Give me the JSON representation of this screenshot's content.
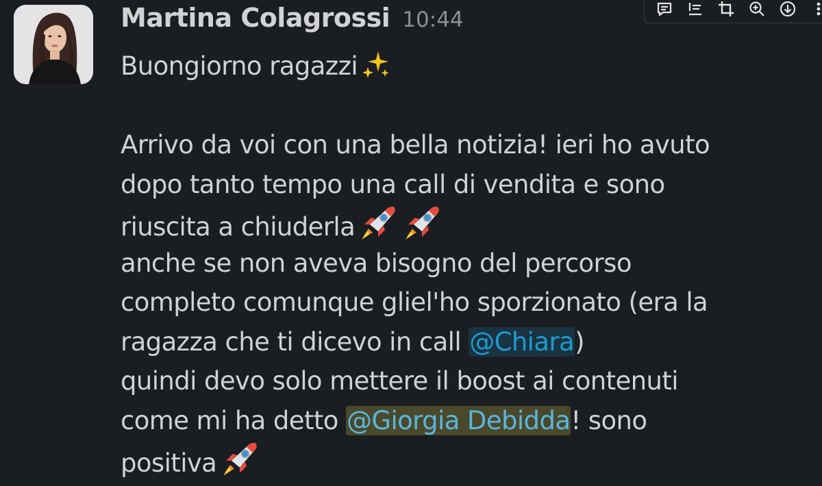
{
  "message": {
    "sender": "Martina Colagrossi",
    "time": "10:44",
    "avatar": "avatar-photo",
    "lines": [
      {
        "text": "Buongiorno ragazzi"
      },
      {
        "text": "Arrivo da voi con una bella notizia! ieri ho avuto"
      },
      {
        "text": "dopo tanto tempo una call di vendita e sono"
      },
      {
        "text": "riuscita a chiuderla"
      },
      {
        "text": "anche se non aveva bisogno del percorso"
      },
      {
        "text": "completo comunque gliel'ho sporzionato (era la"
      },
      {
        "before": "ragazza che ti dicevo in call ",
        "mention": "@Chiara",
        "after": ")"
      },
      {
        "text": "quindi devo solo mettere il boost ai contenuti"
      },
      {
        "before": "come mi ha detto ",
        "mention": "@Giorgia Debidda",
        "after": "! sono"
      },
      {
        "text": "positiva"
      }
    ],
    "emojis": [
      "sparkles-emoji",
      "rocket-emoji"
    ]
  },
  "toolbar": {
    "icons": [
      "comment-icon",
      "text-align-icon",
      "crop-icon",
      "zoom-in-icon",
      "download-icon",
      "more-icon"
    ]
  },
  "colors": {
    "background": "#1a1d21",
    "text": "#d1d2d3",
    "timestamp": "#8d8f91",
    "mention": "#1d9bd1"
  }
}
